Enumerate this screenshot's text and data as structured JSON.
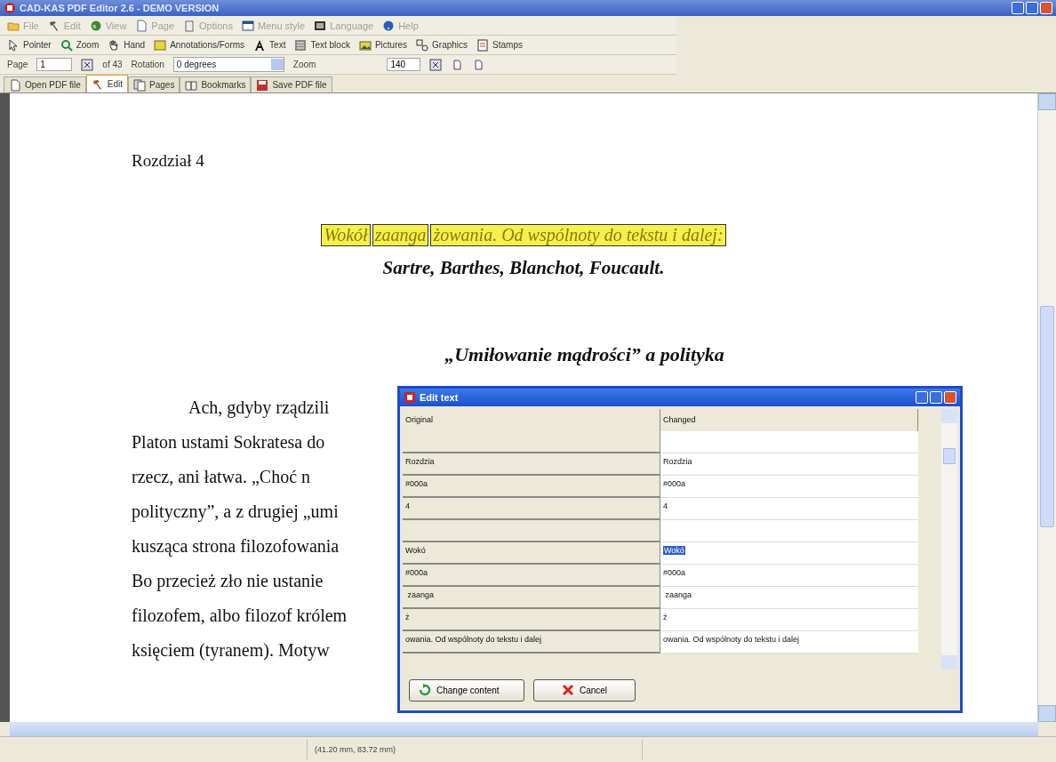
{
  "window": {
    "title": "CAD-KAS PDF Editor 2.6 - DEMO VERSION"
  },
  "menu": [
    "File",
    "Edit",
    "View",
    "Page",
    "Options",
    "Menu style",
    "Language",
    "Help"
  ],
  "tools": [
    "Pointer",
    "Zoom",
    "Hand",
    "Annotations/Forms",
    "Text",
    "Text block",
    "Pictures",
    "Graphics",
    "Stamps"
  ],
  "navigation": {
    "page_label": "Page",
    "page_value": "1",
    "page_count": "of 43",
    "rotation_label": "Rotation",
    "rotation_value": "0 degrees",
    "zoom_label": "Zoom",
    "zoom_value": "140"
  },
  "tabs": [
    {
      "label": "Open PDF file",
      "selected": false
    },
    {
      "label": "Edit",
      "selected": true
    },
    {
      "label": "Pages",
      "selected": false
    },
    {
      "label": "Bookmarks",
      "selected": false
    },
    {
      "label": "Save PDF file",
      "selected": false
    }
  ],
  "document": {
    "chapter": "Rozdział 4",
    "title_segments": [
      {
        "text": "Wokół",
        "highlighted": true
      },
      {
        "text": "zaanga",
        "highlighted": true
      },
      {
        "text": "żowania. Od wspólnoty do tekstu i dalej:",
        "highlighted": true
      }
    ],
    "subtitle": "Sartre, Barthes, Blanchot, Foucault.",
    "section_title": "„Umiłowanie mądrości” a polityka",
    "lines": [
      "Ach, gdyby rządzili",
      "Platon ustami Sokratesa do",
      "rzecz, ani łatwa. „Choć n",
      "polityczny”, a z drugiej „umi",
      "kusząca strona filozofowania",
      "Bo przecież zło nie ustanie",
      "filozofem, albo filozof królem",
      "księciem (tyranem). Motyw"
    ]
  },
  "dialog": {
    "title": "Edit text",
    "columns": [
      "Original",
      "Changed"
    ],
    "rows": [
      {
        "kind": "blank",
        "selected": false
      },
      {
        "kind": "text",
        "original": "Rozdzia",
        "changed": "Rozdzia",
        "selected": false
      },
      {
        "kind": "text",
        "original": "#000a",
        "changed": "#000a",
        "selected": false
      },
      {
        "kind": "text",
        "original": "4",
        "changed": "4",
        "selected": false
      },
      {
        "kind": "blank",
        "selected": false
      },
      {
        "kind": "text",
        "original": "Wokó",
        "changed": "Wokó",
        "selected": true
      },
      {
        "kind": "text",
        "original": "#000a",
        "changed": "#000a",
        "selected": false
      },
      {
        "kind": "text",
        "original": " zaanga",
        "changed": " zaanga",
        "selected": false
      },
      {
        "kind": "text",
        "original": "ż",
        "changed": "ż",
        "selected": false
      },
      {
        "kind": "text",
        "original": "owania. Od wspólnoty do tekstu i dalej",
        "changed": "owania. Od wspólnoty do tekstu i dalej",
        "selected": false
      }
    ],
    "buttons": [
      "Change content",
      "Cancel"
    ]
  },
  "status_bar": {
    "coordinates": "(41.20 mm, 83.72 mm)"
  }
}
